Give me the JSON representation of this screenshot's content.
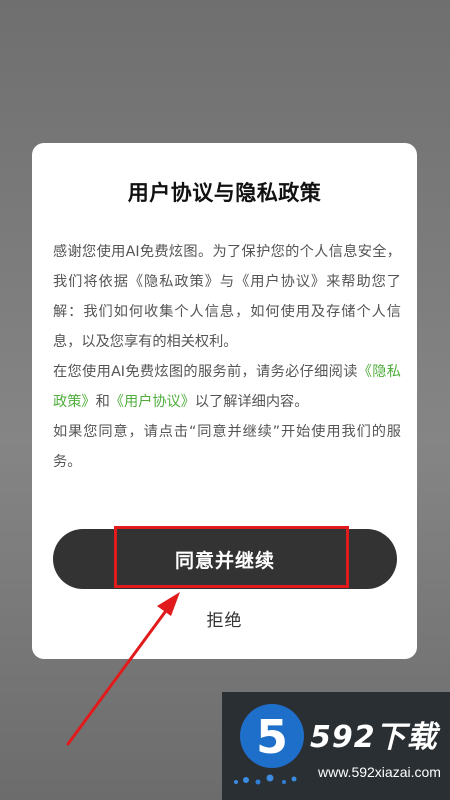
{
  "dialog": {
    "title": "用户协议与隐私政策",
    "paragraph1": "感谢您使用AI免费炫图。为了保护您的个人信息安全，我们将依据《隐私政策》与《用户协议》来帮助您了解：我们如何收集个人信息，如何使用及存储个人信息，以及您享有的相关权利。",
    "paragraph2_prefix": "在您使用AI免费炫图的服务前，请务必仔细阅读",
    "privacy_link": "《隐私政策》",
    "paragraph2_and": "和",
    "agreement_link": "《用户协议》",
    "paragraph2_suffix": "以了解详细内容。",
    "paragraph3": "如果您同意，请点击“同意并继续”开始使用我们的服务。",
    "agree_button": "同意并继续",
    "reject_button": "拒绝"
  },
  "annotation": {
    "highlight_color": "#e11b1b",
    "arrow_color": "#e11b1b"
  },
  "watermark": {
    "badge_number": "5",
    "brand": "592下载",
    "url": "www.592xiazai.com"
  },
  "colors": {
    "link_green": "#4fae3c",
    "button_dark": "#333333"
  }
}
